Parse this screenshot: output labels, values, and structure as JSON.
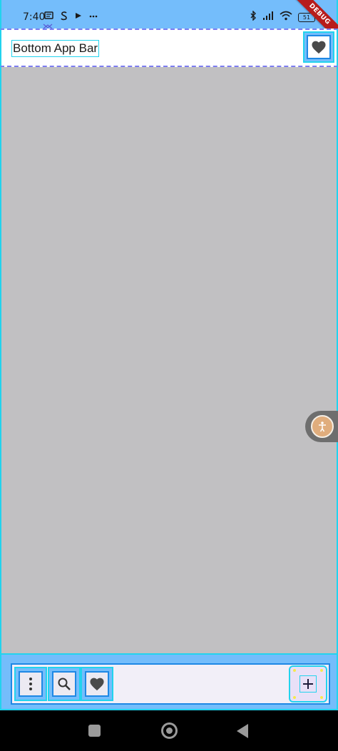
{
  "status_bar": {
    "time": "7:40",
    "battery": "51",
    "left_icons": [
      "message-icon",
      "s-icon",
      "play-icon",
      "more-icon"
    ],
    "right_icons": [
      "bluetooth-icon",
      "signal-icon",
      "wifi-icon",
      "battery-icon"
    ]
  },
  "debug_banner": "DEBUG",
  "app_bar": {
    "title": "Bottom App Bar",
    "action_icon": "heart-icon"
  },
  "bottom_app_bar": {
    "actions": [
      "more-vert-icon",
      "search-icon",
      "heart-icon"
    ],
    "fab_icon": "add-icon"
  },
  "accessibility_button_icon": "accessibility-icon",
  "navigation_bar": [
    "recents-button",
    "home-button",
    "back-button"
  ],
  "colors": {
    "status_bar": "#74bdfb",
    "app_bar_bg": "#ffffff",
    "body_bg": "#c1c0c2",
    "bottom_bar_bg": "#f2eff8",
    "debug_overlay": "#22d3ee",
    "fab_bg": "#e9e0f7",
    "debug_ribbon": "#b71c1c"
  }
}
